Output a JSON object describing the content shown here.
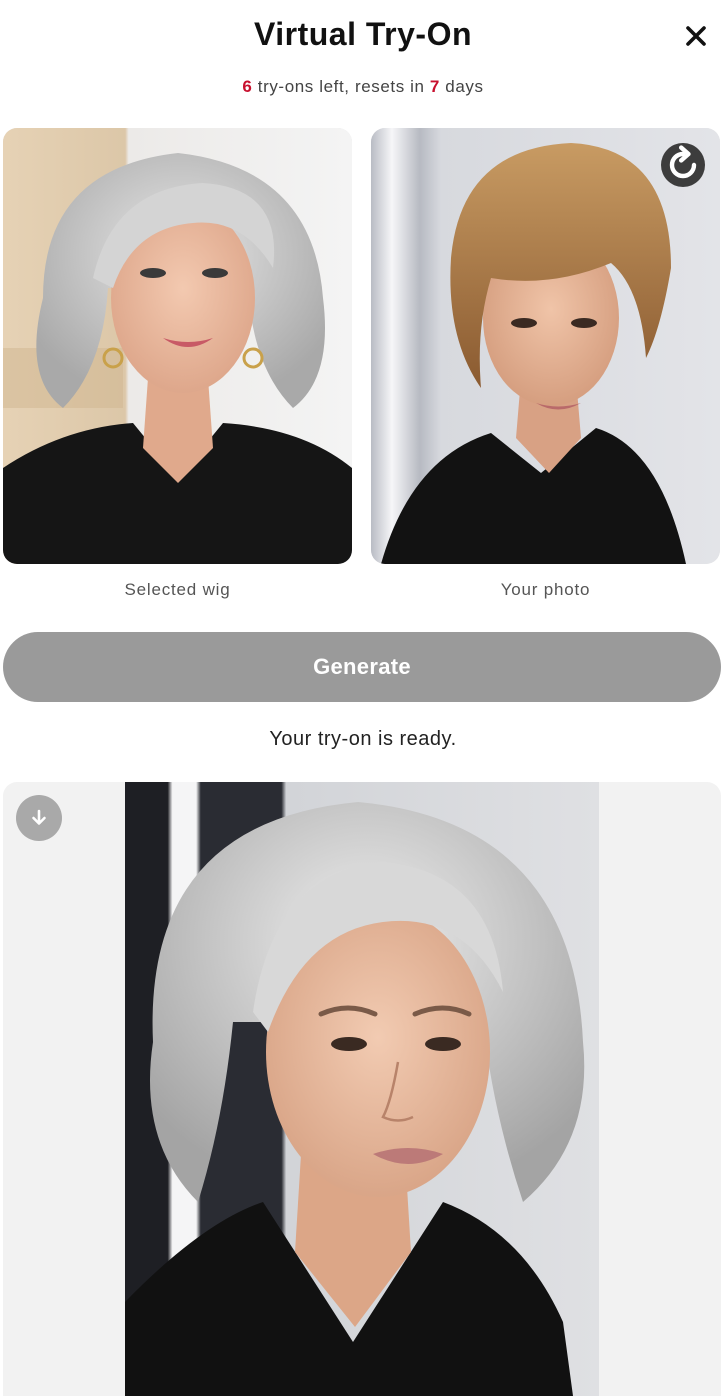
{
  "header": {
    "title": "Virtual Try-On",
    "close_icon": "close-icon"
  },
  "quota": {
    "count": "6",
    "middle_text": " try-ons left, resets in ",
    "days": "7",
    "suffix": " days"
  },
  "inputs": {
    "wig_caption": "Selected wig",
    "photo_caption": "Your photo",
    "refresh_icon": "refresh-icon"
  },
  "actions": {
    "generate_label": "Generate"
  },
  "result": {
    "status_text": "Your try-on is ready.",
    "download_icon": "download-icon"
  },
  "colors": {
    "accent_number": "#c8102e",
    "button_disabled": "#9a9a9a",
    "icon_button_dark": "#3d3d3d",
    "icon_button_light": "#a9a9a9"
  }
}
